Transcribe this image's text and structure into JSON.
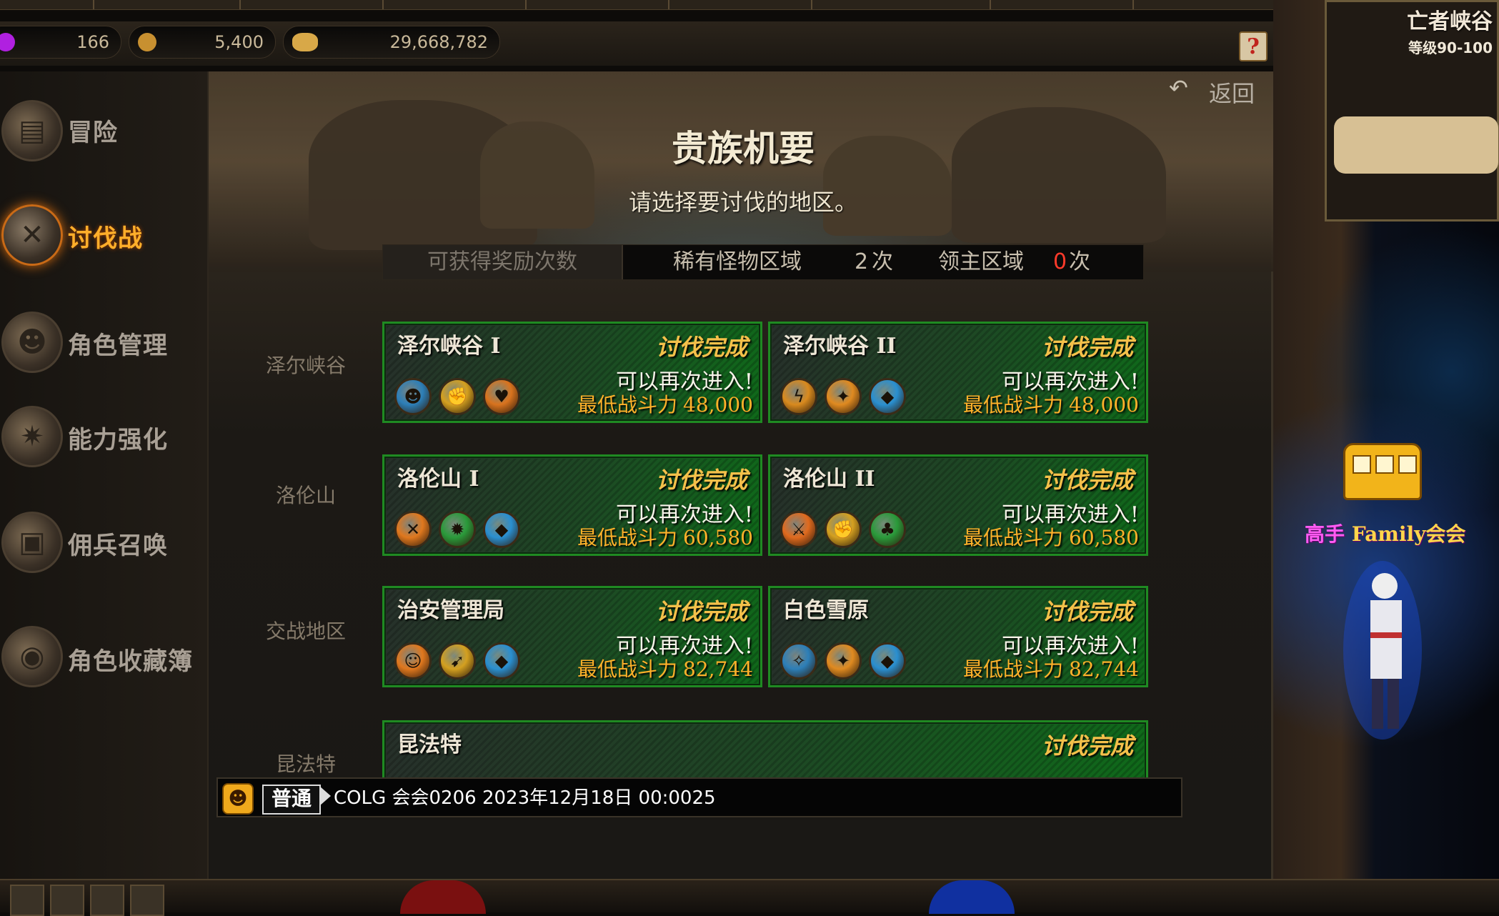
{
  "currency": {
    "purple_value": "166",
    "gold_value": "5,400",
    "coins_value": "29,668,782"
  },
  "sidebar": {
    "items": [
      {
        "label": "冒险",
        "icon": "map-icon",
        "active": false
      },
      {
        "label": "讨伐战",
        "icon": "crossed-swords-icon",
        "active": true
      },
      {
        "label": "角色管理",
        "icon": "character-face-icon",
        "active": false
      },
      {
        "label": "能力强化",
        "icon": "burst-icon",
        "active": false
      },
      {
        "label": "佣兵召唤",
        "icon": "treasure-chest-icon",
        "active": false
      },
      {
        "label": "角色收藏簿",
        "icon": "album-icon",
        "active": false
      }
    ]
  },
  "header": {
    "back_label": "返回",
    "title": "贵族机要",
    "subtitle": "请选择要讨伐的地区。"
  },
  "rewards": {
    "label": "可获得奖励次数",
    "rare_label": "稀有怪物区域",
    "rare_count": "2",
    "lord_label": "领主区域",
    "lord_count": "0",
    "unit": "次"
  },
  "regions": [
    {
      "name": "泽尔峡谷"
    },
    {
      "name": "洛伦山"
    },
    {
      "name": "交战地区"
    },
    {
      "name": "昆法特"
    }
  ],
  "cards": [
    {
      "name": "泽尔峡谷 I",
      "status": "讨伐完成",
      "reenter": "可以再次进入!",
      "power_label": "最低战斗力",
      "power": "48,000",
      "icons": [
        {
          "name": "blue-mask-icon",
          "color": "#2d7fb8",
          "glyph": "☻"
        },
        {
          "name": "gold-fist-icon",
          "color": "#d4a020",
          "glyph": "✊"
        },
        {
          "name": "orange-heart-icon",
          "color": "#d9731e",
          "glyph": "♥"
        }
      ]
    },
    {
      "name": "泽尔峡谷 II",
      "status": "讨伐完成",
      "reenter": "可以再次进入!",
      "power_label": "最低战斗力",
      "power": "48,000",
      "icons": [
        {
          "name": "gold-claw-icon",
          "color": "#d98a1e",
          "glyph": "ϟ"
        },
        {
          "name": "orange-racket-icon",
          "color": "#e08a20",
          "glyph": "✦"
        },
        {
          "name": "blue-diamond-icon",
          "color": "#2a8fd0",
          "glyph": "◆"
        }
      ]
    },
    {
      "name": "洛伦山 I",
      "status": "讨伐完成",
      "reenter": "可以再次进入!",
      "power_label": "最低战斗力",
      "power": "60,580",
      "icons": [
        {
          "name": "crossed-swords-icon",
          "color": "#e0781e",
          "glyph": "✕"
        },
        {
          "name": "green-gear-icon",
          "color": "#2a9a3a",
          "glyph": "✹"
        },
        {
          "name": "blue-diamond-icon",
          "color": "#2a8fd0",
          "glyph": "◆"
        }
      ]
    },
    {
      "name": "洛伦山 II",
      "status": "讨伐完成",
      "reenter": "可以再次进入!",
      "power_label": "最低战斗力",
      "power": "60,580",
      "icons": [
        {
          "name": "sword-slash-icon",
          "color": "#e06a1e",
          "glyph": "⚔"
        },
        {
          "name": "gold-fist-icon",
          "color": "#d4a020",
          "glyph": "✊"
        },
        {
          "name": "green-club-icon",
          "color": "#2a9a3a",
          "glyph": "♣"
        }
      ]
    },
    {
      "name": "治安管理局",
      "status": "讨伐完成",
      "reenter": "可以再次进入!",
      "power_label": "最低战斗力",
      "power": "82,744",
      "icons": [
        {
          "name": "orange-face-icon",
          "color": "#e0781e",
          "glyph": "☺"
        },
        {
          "name": "gold-boot-icon",
          "color": "#d4a020",
          "glyph": "➹"
        },
        {
          "name": "blue-diamond-icon",
          "color": "#2a8fd0",
          "glyph": "◆"
        }
      ]
    },
    {
      "name": "白色雪原",
      "status": "讨伐完成",
      "reenter": "可以再次进入!",
      "power_label": "最低战斗力",
      "power": "82,744",
      "icons": [
        {
          "name": "blue-fish-icon",
          "color": "#2d7fb8",
          "glyph": "✧"
        },
        {
          "name": "orange-racket-icon",
          "color": "#e08a20",
          "glyph": "✦"
        },
        {
          "name": "blue-diamond-icon",
          "color": "#2a8fd0",
          "glyph": "◆"
        }
      ]
    },
    {
      "name": "昆法特",
      "status": "讨伐完成"
    }
  ],
  "chat": {
    "channel": "普通",
    "text": "COLG 会会0206 2023年12月18日 00:0025"
  },
  "minimap": {
    "title": "亡者峡谷",
    "level": "等级90-100"
  },
  "player": {
    "title": "高手",
    "name": "Family会会"
  }
}
